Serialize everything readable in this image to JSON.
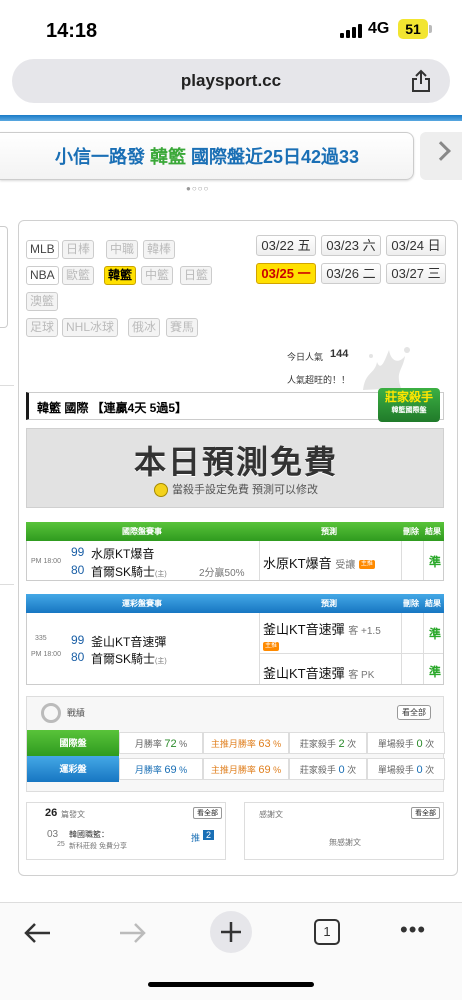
{
  "status": {
    "time": "14:18",
    "network": "4G",
    "battery": "51"
  },
  "browser": {
    "url": "playsport.cc",
    "tab_count": "1"
  },
  "banner": {
    "prefix": "小信一路發 ",
    "highlight": "韓籃",
    "suffix": " 國際盤近25日42過33",
    "dots": "●○○○"
  },
  "sports": {
    "row1": [
      {
        "label": "MLB",
        "state": "normal"
      },
      {
        "label": "日棒",
        "state": "disabled"
      },
      {
        "label": "中職",
        "state": "disabled"
      },
      {
        "label": "韓棒",
        "state": "disabled"
      }
    ],
    "row2": [
      {
        "label": "NBA",
        "state": "normal"
      },
      {
        "label": "歐籃",
        "state": "disabled"
      },
      {
        "label": "韓籃",
        "state": "active"
      },
      {
        "label": "中籃",
        "state": "disabled"
      },
      {
        "label": "日籃",
        "state": "disabled"
      }
    ],
    "row3": [
      {
        "label": "澳籃",
        "state": "disabled"
      }
    ],
    "row4": [
      {
        "label": "足球",
        "state": "disabled"
      },
      {
        "label": "NHL冰球",
        "state": "disabled"
      },
      {
        "label": "俄冰",
        "state": "disabled"
      },
      {
        "label": "賽馬",
        "state": "disabled"
      }
    ]
  },
  "dates": [
    {
      "label": "03/22 五",
      "active": false
    },
    {
      "label": "03/23 六",
      "active": false
    },
    {
      "label": "03/24 日",
      "active": false
    },
    {
      "label": "03/25 一",
      "active": true
    },
    {
      "label": "03/26 二",
      "active": false
    },
    {
      "label": "03/27 三",
      "active": false
    }
  ],
  "popularity": {
    "label": "今日人氣",
    "value": "144",
    "note": "人氣超旺的！！"
  },
  "section_title": "韓籃 國際 【連贏4天 5過5】",
  "killer_badge": {
    "title": "莊家殺手",
    "sub": "韓籃國際盤"
  },
  "free_banner": {
    "title": "本日預測免費",
    "sub": "當殺手設定免費 預測可以修改"
  },
  "intl_table": {
    "headers": {
      "event": "國際盤賽事",
      "pick": "預測",
      "del": "刪除",
      "result": "結果"
    },
    "game": {
      "time": "PM 18:00",
      "away_no": "99",
      "away": "水原KT爆音",
      "home_no": "80",
      "home": "首爾SK騎士",
      "home_tag": "(主)",
      "stat": "2分贏50%",
      "pick_team": "水原KT爆音",
      "pick_note": "受讓",
      "pick_tag": "主推",
      "result": "準"
    }
  },
  "lottery_table": {
    "headers": {
      "event": "運彩盤賽事",
      "pick": "預測",
      "del": "刪除",
      "result": "結果"
    },
    "game": {
      "code": "335",
      "time": "PM 18:00",
      "away_no": "99",
      "away": "釜山KT音速彈",
      "home_no": "80",
      "home": "首爾SK騎士",
      "home_tag": "(主)",
      "picks": [
        {
          "team": "釜山KT音速彈",
          "note": "客 +1.5",
          "tag": "主推",
          "result": "準"
        },
        {
          "team": "釜山KT音速彈",
          "note": "客 PK",
          "tag": "",
          "result": "準"
        }
      ]
    }
  },
  "record": {
    "label": "戰績",
    "all": "看全部",
    "rows": [
      {
        "name": "國際盤",
        "color": "#3fb02c",
        "win_label": "月勝率",
        "win": "72",
        "main_label": "主推月勝率",
        "main": "63",
        "killer_label": "莊家殺手",
        "killer": "2",
        "single_label": "單場殺手",
        "single": "0",
        "unit": "次",
        "pct": "%"
      },
      {
        "name": "運彩盤",
        "color": "#1d8ad6",
        "win_label": "月勝率",
        "win": "69",
        "main_label": "主推月勝率",
        "main": "69",
        "killer_label": "莊家殺手",
        "killer": "0",
        "single_label": "單場殺手",
        "single": "0",
        "unit": "次",
        "pct": "%"
      }
    ]
  },
  "posts": {
    "count": "26",
    "label": "篇發文",
    "all": "看全部",
    "month": "03",
    "day": "25",
    "title": "韓國職籃：",
    "sub": "新科莊殺 免費分享",
    "push": "推",
    "push_count": "2"
  },
  "thanks": {
    "label": "感謝文",
    "all": "看全部",
    "empty": "無感謝文"
  }
}
